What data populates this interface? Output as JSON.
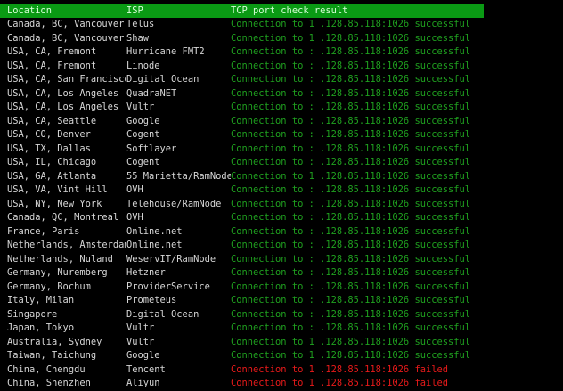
{
  "header": {
    "location": "Location",
    "isp": "ISP",
    "result": "TCP port check result"
  },
  "colors": {
    "header_bg": "#0a9a14",
    "success": "#1fa01f",
    "failed": "#e81a1a",
    "text": "#d6d6d6",
    "background": "#000000"
  },
  "rows": [
    {
      "location": "Canada, BC, Vancouver",
      "isp": "Telus",
      "result": "Connection to 1  .128.85.118:1026 successful",
      "status": "ok"
    },
    {
      "location": "Canada, BC, Vancouver",
      "isp": "Shaw",
      "result": "Connection to 1  .128.85.118:1026 successful",
      "status": "ok"
    },
    {
      "location": "USA, CA, Fremont",
      "isp": "Hurricane FMT2",
      "result": "Connection to :  .128.85.118:1026 successful",
      "status": "ok"
    },
    {
      "location": "USA, CA, Fremont",
      "isp": "Linode",
      "result": "Connection to :  .128.85.118:1026 successful",
      "status": "ok"
    },
    {
      "location": "USA, CA, San Francisco",
      "isp": "Digital Ocean",
      "result": "Connection to :  .128.85.118:1026 successful",
      "status": "ok"
    },
    {
      "location": "USA, CA, Los Angeles",
      "isp": "QuadraNET",
      "result": "Connection to :  .128.85.118:1026 successful",
      "status": "ok"
    },
    {
      "location": "USA, CA, Los Angeles",
      "isp": "Vultr",
      "result": "Connection to :  .128.85.118:1026 successful",
      "status": "ok"
    },
    {
      "location": "USA, CA, Seattle",
      "isp": "Google",
      "result": "Connection to :  .128.85.118:1026 successful",
      "status": "ok"
    },
    {
      "location": "USA, CO, Denver",
      "isp": "Cogent",
      "result": "Connection to :  .128.85.118:1026 successful",
      "status": "ok"
    },
    {
      "location": "USA, TX, Dallas",
      "isp": "Softlayer",
      "result": "Connection to :  .128.85.118:1026 successful",
      "status": "ok"
    },
    {
      "location": "USA, IL, Chicago",
      "isp": "Cogent",
      "result": "Connection to :  .128.85.118:1026 successful",
      "status": "ok"
    },
    {
      "location": "USA, GA, Atlanta",
      "isp": "55 Marietta/RamNode",
      "result": "Connection to 1  .128.85.118:1026 successful",
      "status": "ok"
    },
    {
      "location": "USA, VA, Vint Hill",
      "isp": "OVH",
      "result": "Connection to :  .128.85.118:1026 successful",
      "status": "ok"
    },
    {
      "location": "USA, NY, New York",
      "isp": "Telehouse/RamNode",
      "result": "Connection to :  .128.85.118:1026 successful",
      "status": "ok"
    },
    {
      "location": "Canada, QC, Montreal",
      "isp": "OVH",
      "result": "Connection to :  .128.85.118:1026 successful",
      "status": "ok"
    },
    {
      "location": "France, Paris",
      "isp": "Online.net",
      "result": "Connection to :  .128.85.118:1026 successful",
      "status": "ok"
    },
    {
      "location": "Netherlands, Amsterdam",
      "isp": "Online.net",
      "result": "Connection to :  .128.85.118:1026 successful",
      "status": "ok"
    },
    {
      "location": "Netherlands, Nuland",
      "isp": "WeservIT/RamNode",
      "result": "Connection to :  .128.85.118:1026 successful",
      "status": "ok"
    },
    {
      "location": "Germany, Nuremberg",
      "isp": "Hetzner",
      "result": "Connection to :  .128.85.118:1026 successful",
      "status": "ok"
    },
    {
      "location": "Germany, Bochum",
      "isp": "ProviderService",
      "result": "Connection to :  .128.85.118:1026 successful",
      "status": "ok"
    },
    {
      "location": "Italy, Milan",
      "isp": "Prometeus",
      "result": "Connection to :  .128.85.118:1026 successful",
      "status": "ok"
    },
    {
      "location": "Singapore",
      "isp": "Digital Ocean",
      "result": "Connection to :  .128.85.118:1026 successful",
      "status": "ok"
    },
    {
      "location": "Japan, Tokyo",
      "isp": "Vultr",
      "result": "Connection to :  .128.85.118:1026 successful",
      "status": "ok"
    },
    {
      "location": "Australia, Sydney",
      "isp": "Vultr",
      "result": "Connection to 1  .128.85.118:1026 successful",
      "status": "ok"
    },
    {
      "location": "Taiwan, Taichung",
      "isp": "Google",
      "result": "Connection to 1  .128.85.118:1026 successful",
      "status": "ok"
    },
    {
      "location": "China, Chengdu",
      "isp": "Tencent",
      "result": "Connection to 1  .128.85.118:1026 failed",
      "status": "fail"
    },
    {
      "location": "China, Shenzhen",
      "isp": "Aliyun",
      "result": "Connection to 1  .128.85.118:1026 failed",
      "status": "fail"
    }
  ]
}
